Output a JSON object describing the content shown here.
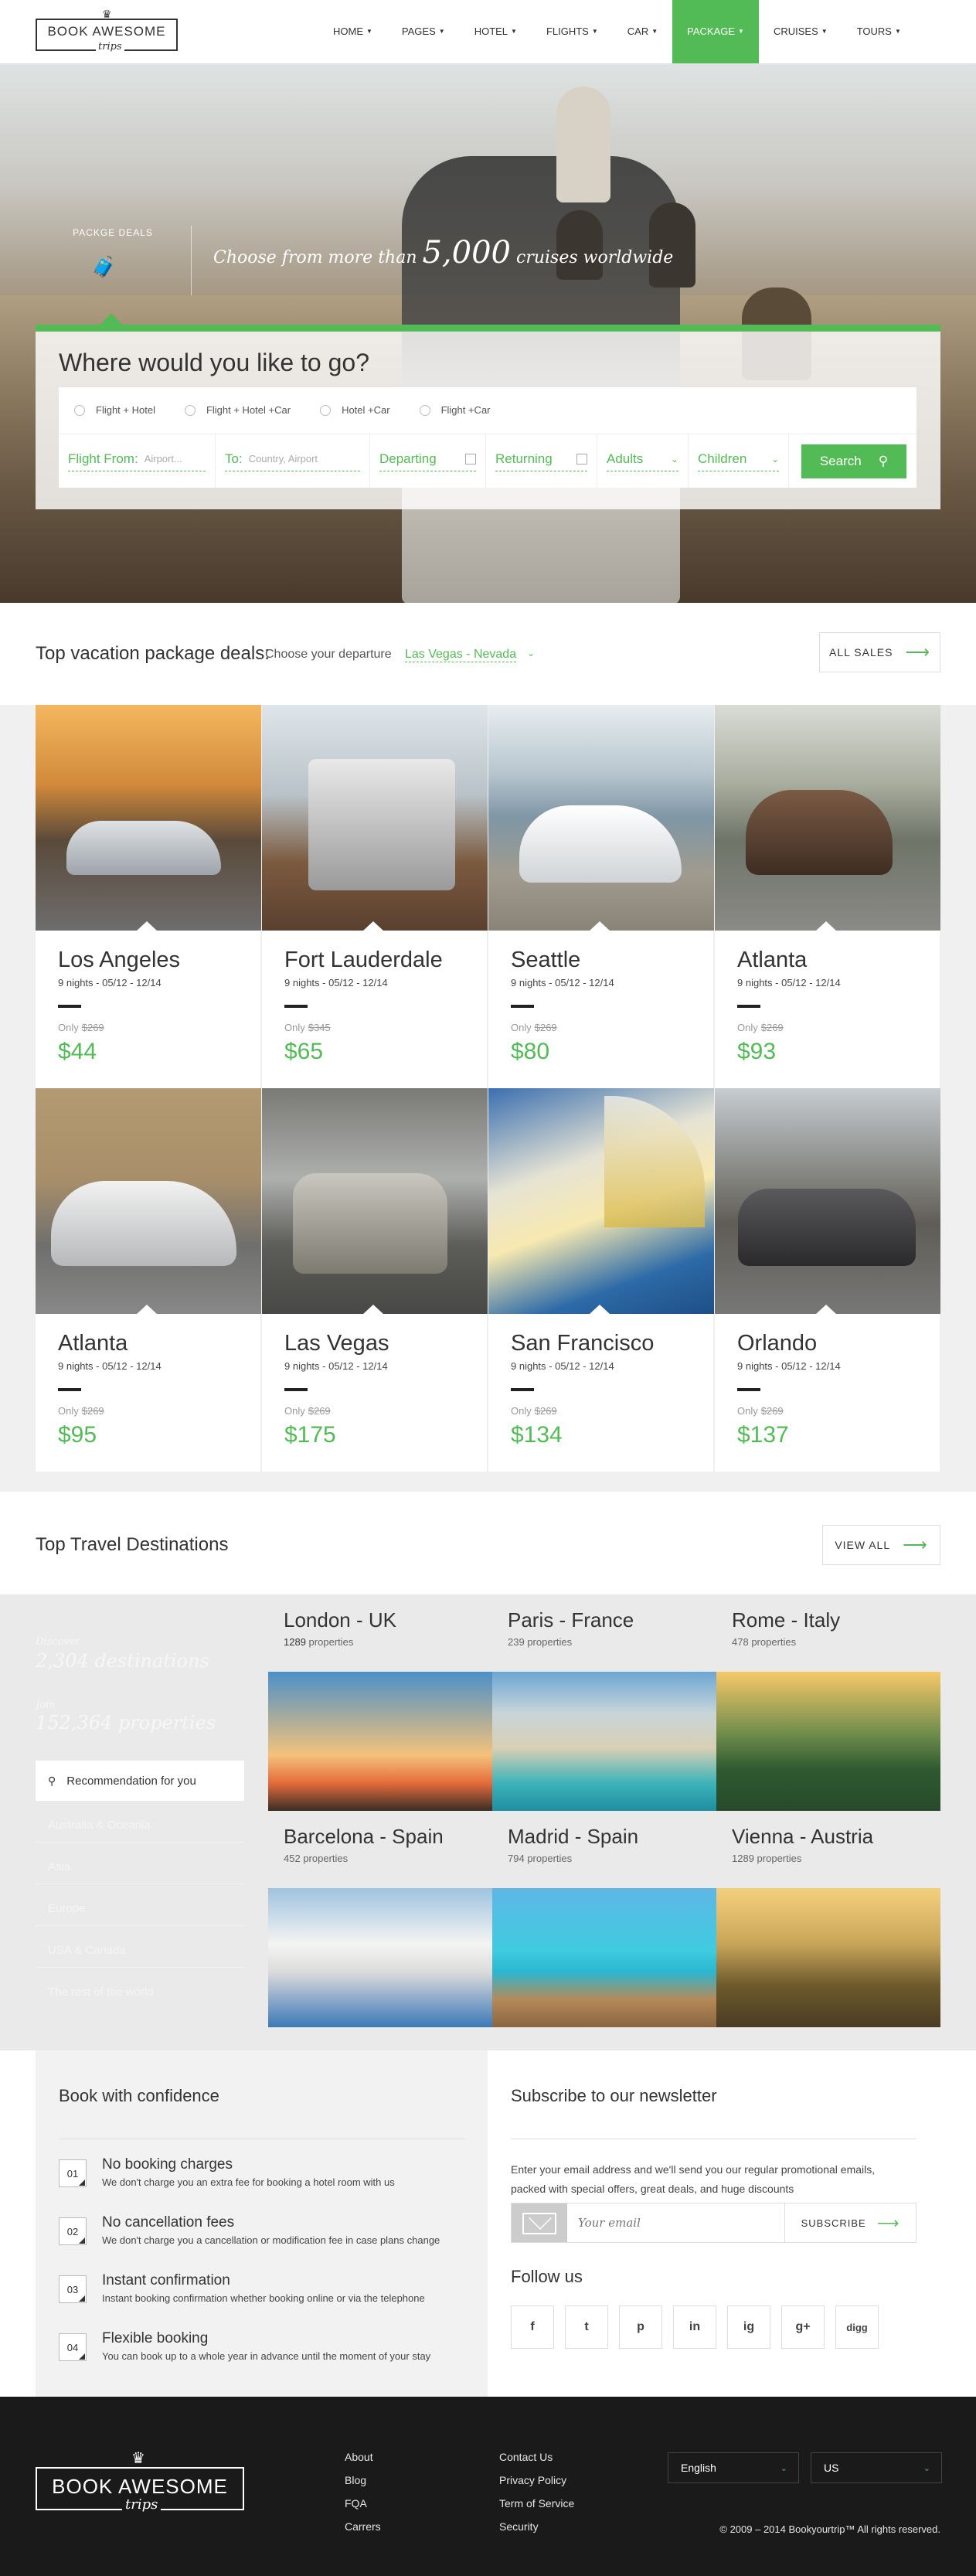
{
  "header": {
    "logo_line1": "BOOK AWESOME",
    "logo_line2": "trips",
    "nav": [
      {
        "label": "HOME"
      },
      {
        "label": "PAGES"
      },
      {
        "label": "HOTEL"
      },
      {
        "label": "FLIGHTS"
      },
      {
        "label": "CAR"
      },
      {
        "label": "PACKAGE"
      },
      {
        "label": "CRUISES"
      },
      {
        "label": "TOURS"
      }
    ],
    "active_nav": "PACKAGE"
  },
  "hero": {
    "deal_label": "PACKGE DEALS",
    "tagline_pre": "Choose from more than",
    "tagline_num": "5,000",
    "tagline_post": "cruises worldwide",
    "search_title": "Where would you like to go?",
    "options": [
      "Flight + Hotel",
      "Flight + Hotel +Car",
      "Hotel +Car",
      "Flight +Car"
    ],
    "from_label": "Flight From:",
    "from_placeholder": "Airport...",
    "to_label": "To:",
    "to_placeholder": "Country, Airport",
    "departing": "Departing",
    "returning": "Returning",
    "adults": "Adults",
    "children": "Children",
    "search_button": "Search"
  },
  "deals": {
    "title": "Top vacation package deals:",
    "sub": "Choose your departure",
    "location": "Las Vegas - Nevada",
    "all_sales": "ALL SALES",
    "cards": [
      {
        "city": "Los Angeles",
        "dates": "9 nights - 05/12 - 12/14",
        "only": "Only",
        "old": "$269",
        "price": "$44"
      },
      {
        "city": "Fort Lauderdale",
        "dates": "9 nights - 05/12 - 12/14",
        "only": "Only",
        "old": "$345",
        "price": "$65"
      },
      {
        "city": "Seattle",
        "dates": "9 nights - 05/12 - 12/14",
        "only": "Only",
        "old": "$269",
        "price": "$80"
      },
      {
        "city": "Atlanta",
        "dates": "9 nights - 05/12 - 12/14",
        "only": "Only",
        "old": "$269",
        "price": "$93"
      },
      {
        "city": "Atlanta",
        "dates": "9 nights - 05/12 - 12/14",
        "only": "Only",
        "old": "$269",
        "price": "$95"
      },
      {
        "city": "Las Vegas",
        "dates": "9 nights - 05/12 - 12/14",
        "only": "Only",
        "old": "$269",
        "price": "$175"
      },
      {
        "city": "San Francisco",
        "dates": "9 nights - 05/12 - 12/14",
        "only": "Only",
        "old": "$269",
        "price": "$134"
      },
      {
        "city": "Orlando",
        "dates": "9 nights - 05/12 - 12/14",
        "only": "Only",
        "old": "$269",
        "price": "$137"
      }
    ]
  },
  "destinations": {
    "title": "Top Travel Destinations",
    "view_all": "VIEW ALL",
    "side_label1": "Discover",
    "side_stat1": "2,304 destinations",
    "side_label2": "Join",
    "side_stat2": "152,364 properties",
    "recommendation": "Recommendation for you",
    "regions": [
      "Australia & Oceania",
      "Asia",
      "Europe",
      "USA & Canada",
      "The rest of the world"
    ],
    "cells": [
      {
        "name": "London - UK",
        "count": "1289",
        "suffix": "properties"
      },
      {
        "name": "Paris - France",
        "count": "239",
        "suffix": "properties"
      },
      {
        "name": "Rome - Italy",
        "count": "478",
        "suffix": "properties"
      },
      {
        "name": "Barcelona - Spain",
        "count": "452",
        "suffix": "properties"
      },
      {
        "name": "Madrid - Spain",
        "count": "794",
        "suffix": "properties"
      },
      {
        "name": "Vienna - Austria",
        "count": "1289",
        "suffix": "properties"
      }
    ]
  },
  "confidence": {
    "title": "Book with confidence",
    "items": [
      {
        "num": "01",
        "title": "No booking charges",
        "desc": "We don't charge you an extra fee for booking a hotel room with us"
      },
      {
        "num": "02",
        "title": "No cancellation fees",
        "desc": "We don't charge you a cancellation or modification fee in case plans change"
      },
      {
        "num": "03",
        "title": "Instant confirmation",
        "desc": "Instant booking confirmation whether booking online or via the telephone"
      },
      {
        "num": "04",
        "title": "Flexible booking",
        "desc": "You can book up to a whole year in advance until the moment of your stay"
      }
    ]
  },
  "newsletter": {
    "title": "Subscribe to our newsletter",
    "text": "Enter your email address and we'll send you our regular promotional emails, packed with special offers, great deals, and huge discounts",
    "placeholder": "Your email",
    "button": "SUBSCRIBE",
    "follow": "Follow us",
    "socials": [
      "f",
      "t",
      "p",
      "in",
      "ig",
      "g+",
      "digg"
    ]
  },
  "footer": {
    "logo_line1": "BOOK AWESOME",
    "logo_line2": "trips",
    "col1": [
      "About",
      "Blog",
      "FQA",
      "Carrers"
    ],
    "col2": [
      "Contact Us",
      "Privacy Policy",
      "Term of Service",
      "Security"
    ],
    "language": "English",
    "currency": "US",
    "copyright": "© 2009 – 2014 Bookyourtrip™ All rights reserved."
  },
  "colors": {
    "accent": "#52bb56",
    "footer_bg": "#1a1a1a"
  }
}
